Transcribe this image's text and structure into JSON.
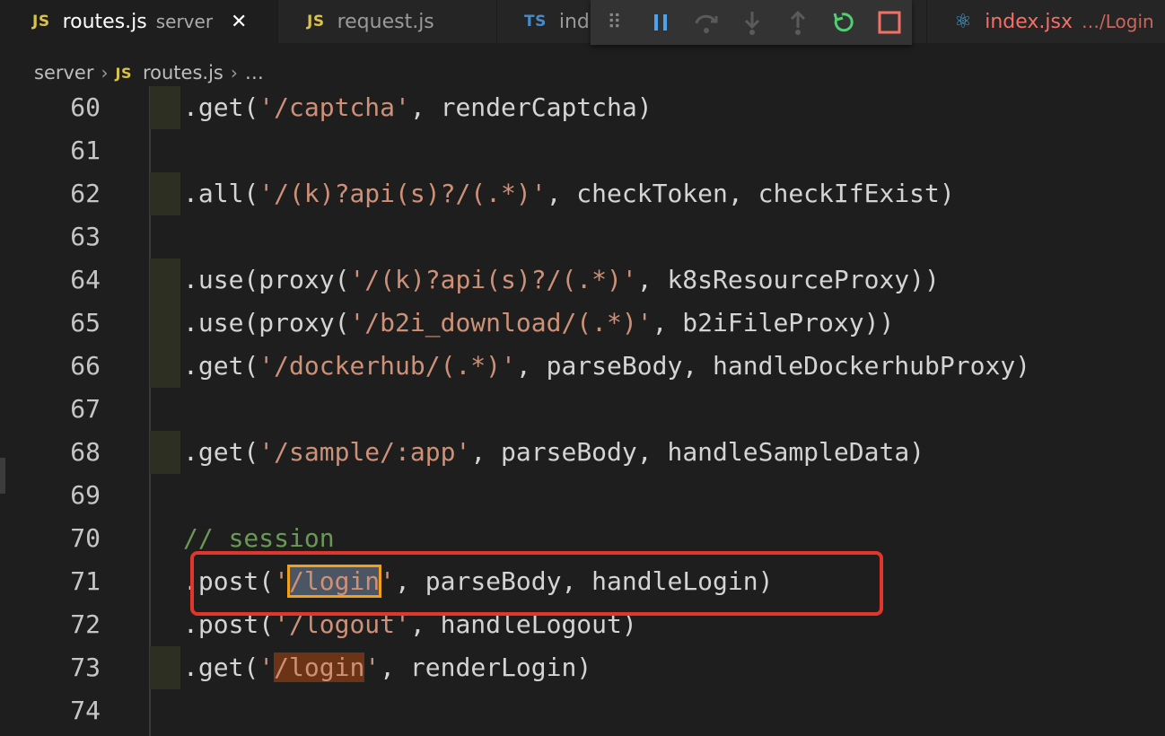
{
  "tabs": [
    {
      "icon": "JS",
      "name": "routes.js",
      "desc": "server",
      "close": "✕"
    },
    {
      "icon": "JS",
      "name": "request.js"
    },
    {
      "icon": "TS",
      "name": "inde"
    },
    {
      "icon": "⚛",
      "name": "index.jsx",
      "desc": "…/Login"
    }
  ],
  "debug_toolbar": {
    "grip": "⠿",
    "actions": [
      "pause-icon",
      "step-over-icon",
      "step-into-icon",
      "step-out-icon",
      "restart-icon",
      "stop-icon"
    ]
  },
  "breadcrumb": {
    "folder": "server",
    "file_icon": "JS",
    "file": "routes.js",
    "more": "…",
    "separator": "›"
  },
  "colors": {
    "string": "#ce9178",
    "comment": "#6a9955",
    "text": "#d4d4d4",
    "annotation": "#e0362b",
    "find_highlight": "#f0a01a"
  },
  "lines": [
    {
      "num": "60",
      "parts": [
        ".get(",
        "'/captcha'",
        ", renderCaptcha)"
      ]
    },
    {
      "num": "61"
    },
    {
      "num": "62",
      "parts": [
        ".all(",
        "'/(k)?api(s)?/(.*)'",
        ", checkToken, checkIfExist)"
      ]
    },
    {
      "num": "63"
    },
    {
      "num": "64",
      "parts": [
        ".use(proxy(",
        "'/(k)?api(s)?/(.*)'",
        ", k8sResourceProxy))"
      ]
    },
    {
      "num": "65",
      "parts": [
        ".use(proxy(",
        "'/b2i_download/(.*)'",
        ", b2iFileProxy))"
      ]
    },
    {
      "num": "66",
      "parts": [
        ".get(",
        "'/dockerhub/(.*)'",
        ", parseBody, handleDockerhubProxy)"
      ]
    },
    {
      "num": "67"
    },
    {
      "num": "68",
      "parts": [
        ".get(",
        "'/sample/:app'",
        ", parseBody, handleSampleData)"
      ]
    },
    {
      "num": "69"
    },
    {
      "num": "70",
      "comment": "// session"
    },
    {
      "num": "71",
      "parts": [
        ".post(",
        "'",
        "/login",
        "'",
        ", parseBody, handleLogin)"
      ]
    },
    {
      "num": "72",
      "parts": [
        ".post(",
        "'/logout'",
        ", handleLogout)"
      ]
    },
    {
      "num": "73",
      "parts": [
        ".get(",
        "'",
        "/login",
        "'",
        ", renderLogin)"
      ]
    },
    {
      "num": "74"
    }
  ]
}
